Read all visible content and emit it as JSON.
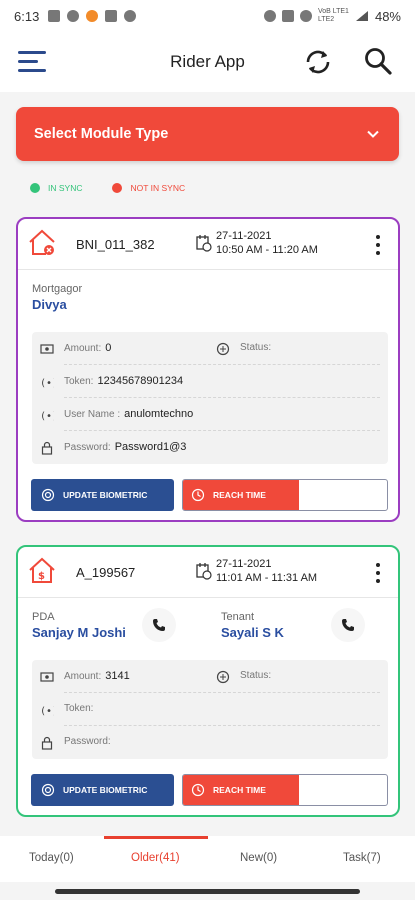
{
  "status_bar": {
    "time": "6:13",
    "network_top": "VoB LTE1",
    "network_bottom": "LTE2",
    "battery": "48%"
  },
  "app_bar": {
    "title": "Rider App"
  },
  "module_select": {
    "label": "Select Module Type"
  },
  "legend": {
    "in_sync": {
      "label": "IN SYNC",
      "color": "#33c47a"
    },
    "not_in_sync": {
      "label": "NOT IN SYNC",
      "color": "#f0493a"
    }
  },
  "cards": [
    {
      "id": "BNI_011_382",
      "date": "27-11-2021",
      "time_range": "10:50 AM - 11:20 AM",
      "border_color": "#9b3dc1",
      "role1_label": "Mortgagor",
      "role1_name": "Divya",
      "amount_label": "Amount:",
      "amount": "0",
      "status_label": "Status:",
      "token_label": "Token:",
      "token": "12345678901234",
      "username_label": "User Name :",
      "username": "anulomtechno",
      "password_label": "Password:",
      "password": "Password1@3",
      "biometric_label": "UPDATE BIOMETRIC",
      "reach_label": "REACH TIME"
    },
    {
      "id": "A_199567",
      "date": "27-11-2021",
      "time_range": "11:01 AM - 11:31 AM",
      "border_color": "#33c47a",
      "role1_label": "PDA",
      "role1_name": "Sanjay M Joshi",
      "role2_label": "Tenant",
      "role2_name": "Sayali S K",
      "amount_label": "Amount:",
      "amount": "3141",
      "status_label": "Status:",
      "token_label": "Token:",
      "password_label": "Password:",
      "biometric_label": "UPDATE BIOMETRIC",
      "reach_label": "REACH TIME"
    }
  ],
  "tabs": [
    {
      "label": "Today(0)",
      "active": false
    },
    {
      "label": "Older(41)",
      "active": true
    },
    {
      "label": "New(0)",
      "active": false
    },
    {
      "label": "Task(7)",
      "active": false
    }
  ]
}
